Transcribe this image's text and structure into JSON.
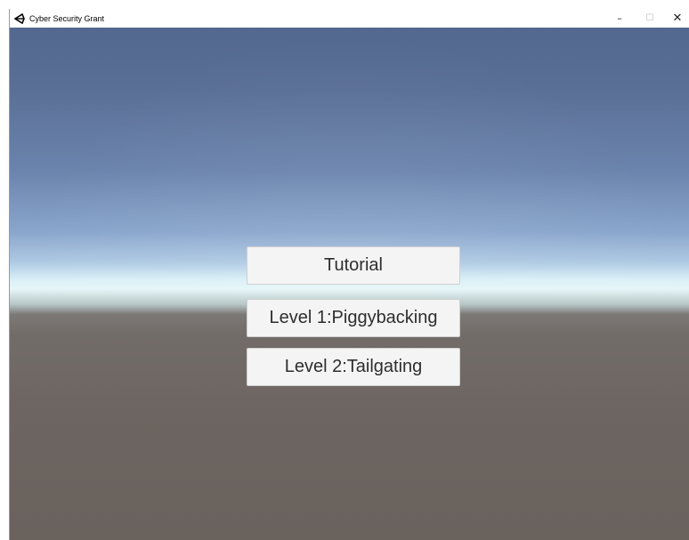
{
  "window": {
    "title": "Cyber Security Grant",
    "app_icon": "unity-logo-icon",
    "controls": {
      "minimize": "–",
      "maximize": "☐",
      "close": "✕"
    }
  },
  "menu": {
    "buttons": [
      {
        "label": "Tutorial"
      },
      {
        "label": "Level 1:Piggybacking"
      },
      {
        "label": "Level 2:Tailgating"
      }
    ]
  },
  "colors": {
    "sky_top": "#53688f",
    "horizon": "#e6f6f8",
    "ground": "#6a625d",
    "button_bg": "#f4f4f4",
    "button_text": "#2e2e2e"
  }
}
